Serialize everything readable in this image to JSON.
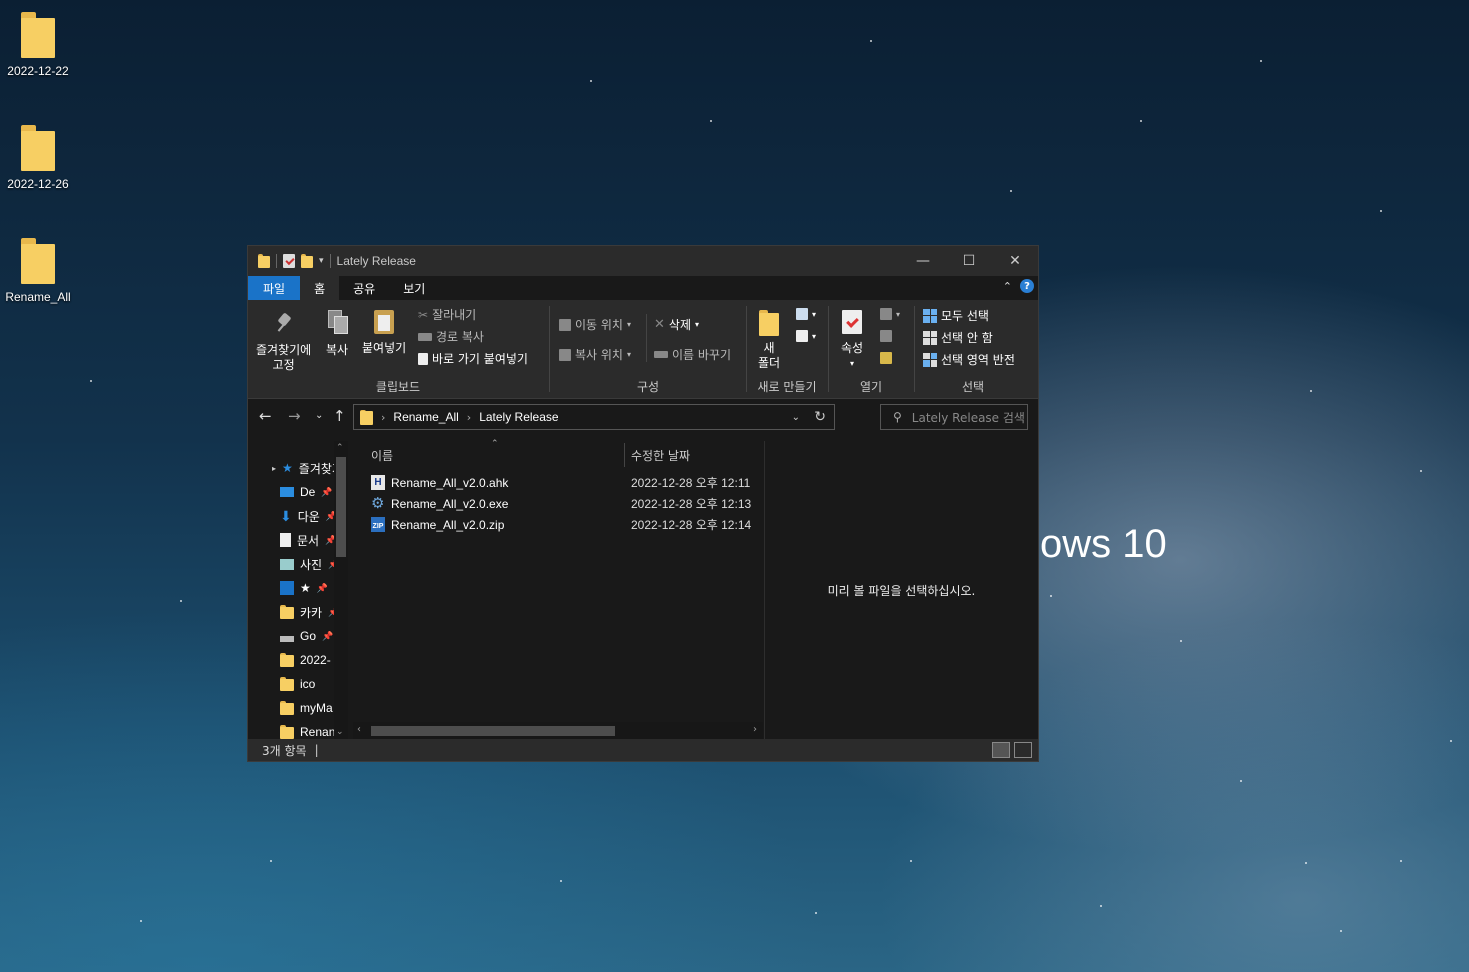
{
  "desktop": {
    "icons": [
      {
        "label": "2022-12-22"
      },
      {
        "label": "2022-12-26"
      },
      {
        "label": "Rename_All"
      }
    ],
    "wallpaper_text": "ows 10"
  },
  "window": {
    "title": "Lately Release",
    "controls": {
      "minimize": "—",
      "maximize": "☐",
      "close": "✕"
    },
    "tabs": [
      {
        "label": "파일"
      },
      {
        "label": "홈"
      },
      {
        "label": "공유"
      },
      {
        "label": "보기"
      }
    ],
    "ribbon": {
      "clipboard": {
        "label": "클립보드",
        "pin_label_1": "즐겨찾기에",
        "pin_label_2": "고정",
        "copy": "복사",
        "paste": "붙여넣기",
        "cut": "잘라내기",
        "copy_path": "경로 복사",
        "paste_shortcut": "바로 가기 붙여넣기"
      },
      "organize": {
        "label": "구성",
        "move_to": "이동 위치",
        "copy_to": "복사 위치",
        "delete": "삭제",
        "rename": "이름 바꾸기"
      },
      "new": {
        "label": "새로 만들기",
        "new_folder_1": "새",
        "new_folder_2": "폴더"
      },
      "open": {
        "label": "열기",
        "properties": "속성"
      },
      "select": {
        "label": "선택",
        "select_all": "모두 선택",
        "select_none": "선택 안 함",
        "invert": "선택 영역 반전"
      }
    },
    "address": {
      "crumbs": [
        "Rename_All",
        "Lately Release"
      ],
      "search_placeholder": "Lately Release 검색"
    },
    "nav_pane": {
      "items": [
        {
          "label": "즐겨찾기",
          "icon": "star-icon"
        },
        {
          "label": "De",
          "icon": "desktop-icon"
        },
        {
          "label": "다운",
          "icon": "download-icon"
        },
        {
          "label": "문서",
          "icon": "document-icon"
        },
        {
          "label": "사진",
          "icon": "picture-icon"
        },
        {
          "label": "★",
          "icon": "blue-folder-icon"
        },
        {
          "label": "카카",
          "icon": "folder-icon"
        },
        {
          "label": "Go",
          "icon": "drive-icon"
        },
        {
          "label": "2022-",
          "icon": "folder-icon"
        },
        {
          "label": "ico",
          "icon": "folder-icon"
        },
        {
          "label": "myMa",
          "icon": "folder-icon"
        },
        {
          "label": "Renan",
          "icon": "folder-icon"
        }
      ]
    },
    "file_list": {
      "columns": {
        "name": "이름",
        "modified": "수정한 날짜"
      },
      "rows": [
        {
          "name": "Rename_All_v2.0.ahk",
          "date": "2022-12-28 오후 12:11",
          "icon": "ahk-file-icon"
        },
        {
          "name": "Rename_All_v2.0.exe",
          "date": "2022-12-28 오후 12:13",
          "icon": "exe-gear-icon"
        },
        {
          "name": "Rename_All_v2.0.zip",
          "date": "2022-12-28 오후 12:14",
          "icon": "zip-file-icon"
        }
      ]
    },
    "preview": {
      "message": "미리 볼 파일을 선택하십시오."
    },
    "status": {
      "item_count": "3개 항목"
    }
  }
}
